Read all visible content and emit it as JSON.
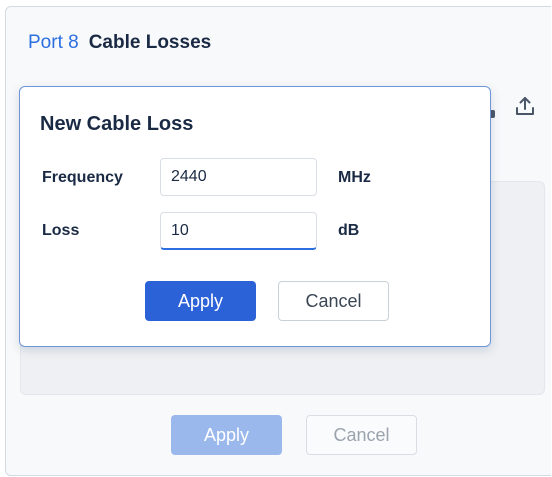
{
  "header": {
    "port_label": "Port 8",
    "title": "Cable Losses"
  },
  "toolbar": {
    "upload_icon": "upload-icon"
  },
  "footer": {
    "apply_label": "Apply",
    "cancel_label": "Cancel"
  },
  "dialog": {
    "title": "New Cable Loss",
    "frequency": {
      "label": "Frequency",
      "value": "2440",
      "unit": "MHz"
    },
    "loss": {
      "label": "Loss",
      "value": "10",
      "unit": "dB"
    },
    "apply_label": "Apply",
    "cancel_label": "Cancel"
  },
  "colors": {
    "accent": "#2c62d8",
    "accent_disabled": "#9bb8ec",
    "title_blue": "#2c6fe0",
    "text_dark": "#1a2a44",
    "dialog_border": "#6f95d8"
  }
}
